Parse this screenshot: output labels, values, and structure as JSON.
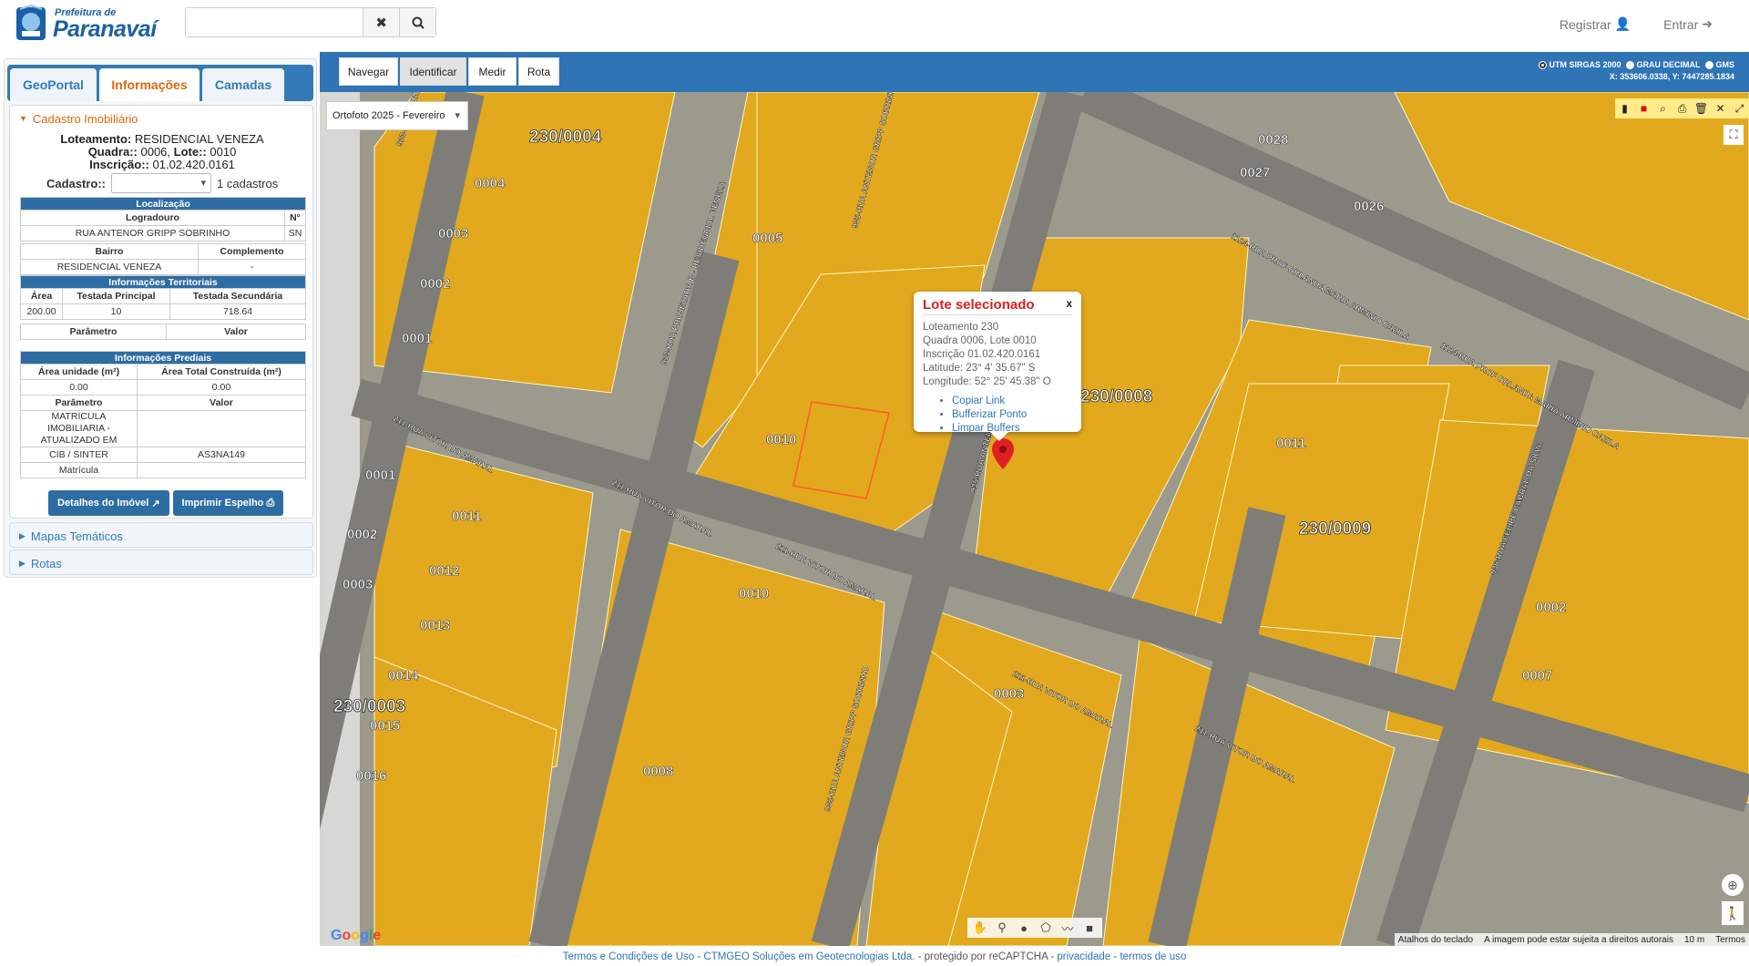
{
  "header": {
    "logo_small": "Prefeitura de",
    "logo_name": "Paranavaí",
    "search_value": "",
    "register": "Registrar",
    "login": "Entrar"
  },
  "sidebar": {
    "tabs": [
      "GeoPortal",
      "Informações",
      "Camadas"
    ],
    "section_cadastro": "Cadastro Imobiliário",
    "loteamento_label": "Loteamento:",
    "loteamento_value": "RESIDENCIAL VENEZA",
    "quadra_label": "Quadra::",
    "quadra_value": "0006,",
    "lote_label": "Lote::",
    "lote_value": "0010",
    "inscricao_label": "Inscrição::",
    "inscricao_value": "01.02.420.0161",
    "cadastro_label": "Cadastro::",
    "cadastro_count": "1 cadastros",
    "localizacao": {
      "title": "Localização",
      "h_logradouro": "Logradouro",
      "h_numero": "N°",
      "logradouro": "RUA ANTENOR GRIPP SOBRINHO",
      "numero": "SN",
      "h_bairro": "Bairro",
      "h_complemento": "Complemento",
      "bairro": "RESIDENCIAL VENEZA",
      "complemento": "-"
    },
    "territoriais": {
      "title": "Informações Territoriais",
      "h_area": "Área",
      "h_testada_principal": "Testada Principal",
      "h_testada_secundaria": "Testada Secundária",
      "area": "200.00",
      "testada_principal": "10",
      "testada_secundaria": "718.64",
      "h_parametro": "Parâmetro",
      "h_valor": "Valor"
    },
    "prediais": {
      "title": "Informações Prediais",
      "h_area_unidade": "Área unidade (m²)",
      "h_area_total": "Área Total Construída (m²)",
      "area_unidade": "0.00",
      "area_total": "0.00",
      "h_parametro": "Parâmetro",
      "h_valor": "Valor",
      "matricula_atualizada": "MATRICULA IMOBILIARIA - ATUALIZADO EM",
      "cib_label": "CIB / SINTER",
      "cib_value": "AS3NA149",
      "matricula": "Matrícula"
    },
    "btn_detalhes": "Detalhes do Imóvel",
    "btn_imprimir": "Imprimir Espelho",
    "section_mapas": "Mapas Temáticos",
    "section_rotas": "Rotas"
  },
  "map": {
    "modes": [
      "Navegar",
      "Identificar",
      "Medir",
      "Rota"
    ],
    "coord_options": [
      "UTM SIRGAS 2000",
      "GRAU DECIMAL",
      "GMS"
    ],
    "coord_readout": "X: 353606.0338, Y: 7447285.1834",
    "layer": "Ortofoto 2025 - Fevereiro",
    "popup": {
      "title": "Lote selecionado",
      "close": "x",
      "lines": [
        "Loteamento 230",
        "Quadra 0006, Lote 0010",
        "Inscrição 01.02.420.0161",
        "Latitude: 23° 4' 35.67\" S",
        "Longitude: 52° 25' 45.38\" O"
      ],
      "links": [
        "Copiar Link",
        "Bufferizar Ponto",
        "Limpar Buffers"
      ]
    },
    "attribution": [
      "Atalhos do teclado",
      "A imagem pode estar sujeita a direitos autorais",
      "10 m",
      "Termos"
    ],
    "google": "Google",
    "street_labels": [
      "211-RUA VITOR DO AMARAL",
      "211-RUA VITOR DO AMARAL",
      "211-RUA VITOR DO AMARAL",
      "211-RUA VITOR DO AMARAL",
      "211-RUA VITOR DO AMARAL",
      "935-RUA ANTENOR GRIPP SOBRINHO",
      "935-RUA ANTENOR GRIPP SOBRINHO",
      "935-RUA ANTENOR GRIPP SOBRINHO",
      "1124-RUA PROF ORLANDA MARIA ARMINIO CAZILA",
      "1124-RUA PROF ORLANDA MARIA ARMINIO CAZILA",
      "936-RUA FELIPE CABRAL DA SILVA",
      "933-RUA PROJETADA B - RESIDENCIAL VENEZA",
      "933-RUA RUBENS PEREIRA DA SILVA"
    ],
    "lot_labels": [
      "0004",
      "0003",
      "0002",
      "0001",
      "0005",
      "0001",
      "0011",
      "0002",
      "0003",
      "0012",
      "0013",
      "0014",
      "0015",
      "0016",
      "0007",
      "0011",
      "0010",
      "0028",
      "0027",
      "0026",
      "0002",
      "0003",
      "0010",
      "0008"
    ],
    "block_labels": [
      "230/0004",
      "230/0008",
      "230/0009",
      "230/0003"
    ]
  },
  "footer": {
    "t1": "Termos e Condições de Uso",
    "t2": " - ",
    "t3": "CTMGEO Soluções em Geotecnologias Ltda.",
    "t4": " - protegido por reCAPTCHA - ",
    "t5": "privacidade",
    "t6": " - ",
    "t7": "termos de uso"
  },
  "colors": {
    "primary": "#2f74b5",
    "accent": "#d96a0b",
    "lot_fill": "#e0a81c",
    "popup_title": "#d62020"
  }
}
